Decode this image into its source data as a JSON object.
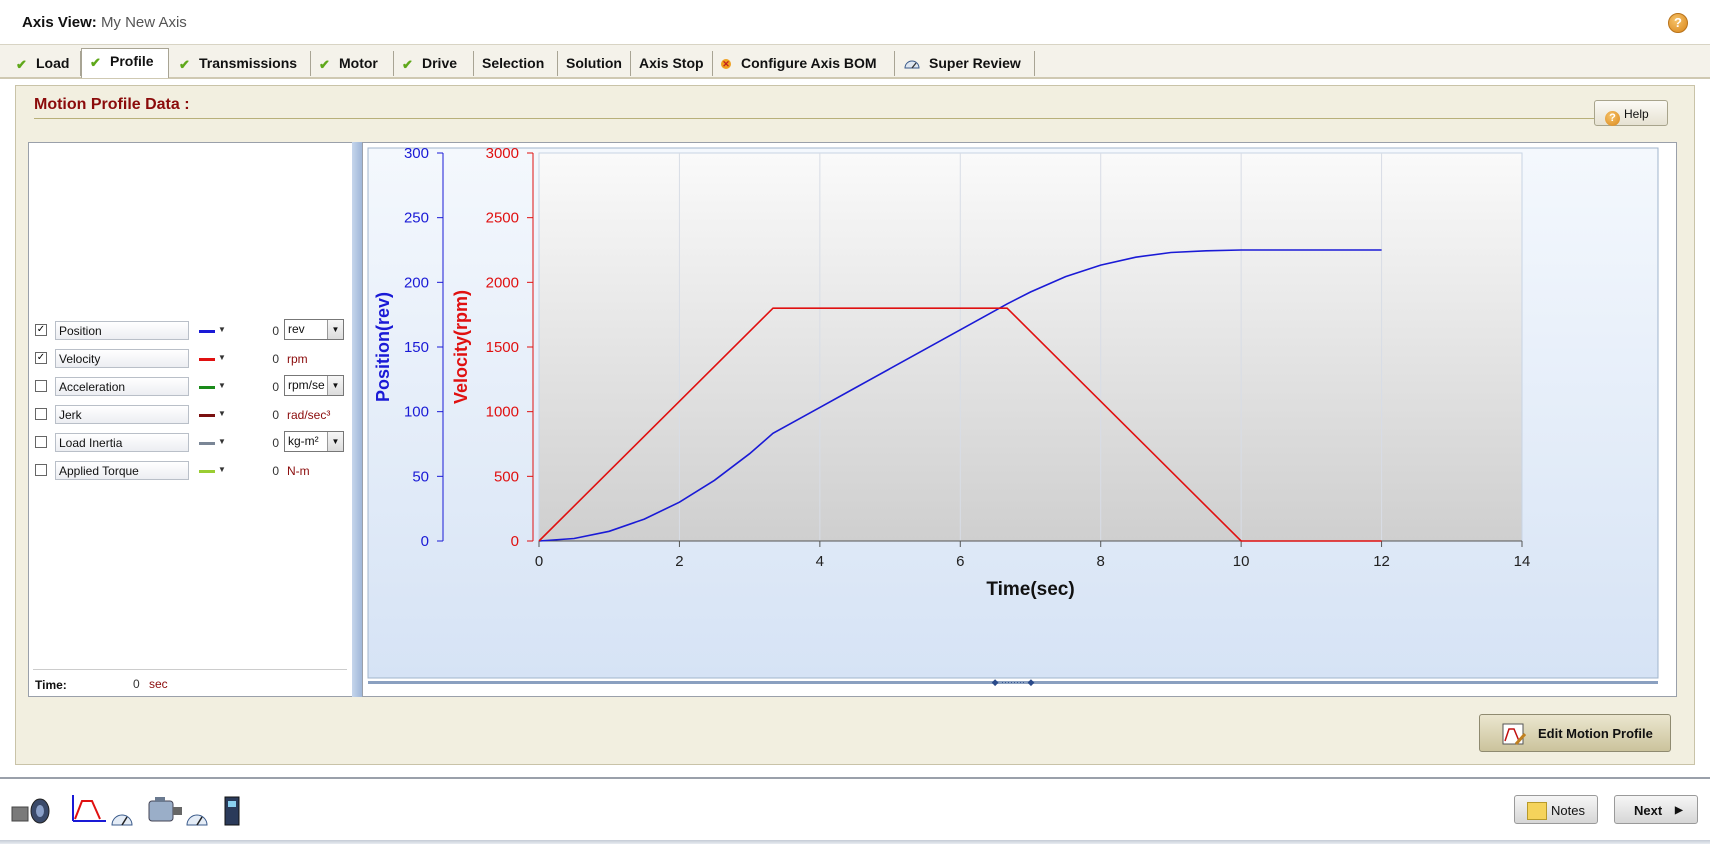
{
  "window": {
    "title": "Axis View:",
    "subtitle": "My New Axis",
    "help_icon": "question-icon"
  },
  "tabs": [
    {
      "label": "Load",
      "status": "check"
    },
    {
      "label": "Profile",
      "status": "check",
      "active": true
    },
    {
      "label": "Transmissions",
      "status": "check"
    },
    {
      "label": "Motor",
      "status": "check"
    },
    {
      "label": "Drive",
      "status": "check"
    },
    {
      "label": "Selection"
    },
    {
      "label": "Solution"
    },
    {
      "label": "Axis Stop"
    },
    {
      "label": "Configure Axis BOM",
      "status": "error"
    },
    {
      "label": "Super Review",
      "status": "gauge"
    }
  ],
  "panel": {
    "title": "Motion Profile Data :",
    "help_label": "Help"
  },
  "series_list": [
    {
      "checked": true,
      "name": "Position",
      "color": "#1a1ad6",
      "value": "0",
      "unit": "rev",
      "unit_is_select": true
    },
    {
      "checked": true,
      "name": "Velocity",
      "color": "#e01010",
      "value": "0",
      "unit": "rpm",
      "unit_is_select": false
    },
    {
      "checked": false,
      "name": "Acceleration",
      "color": "#1a8a1a",
      "value": "0",
      "unit": "rpm/se",
      "unit_is_select": true
    },
    {
      "checked": false,
      "name": "Jerk",
      "color": "#7a1010",
      "value": "0",
      "unit": "rad/sec³",
      "unit_is_select": false
    },
    {
      "checked": false,
      "name": "Load Inertia",
      "color": "#7a8696",
      "value": "0",
      "unit": "kg-m²",
      "unit_is_select": true
    },
    {
      "checked": false,
      "name": "Applied Torque",
      "color": "#9acd32",
      "value": "0",
      "unit": "N-m",
      "unit_is_select": false
    }
  ],
  "time": {
    "label": "Time:",
    "value": "0",
    "unit": "sec"
  },
  "chart_data": {
    "type": "line",
    "xlabel": "Time(sec)",
    "xlim": [
      0,
      14
    ],
    "x_ticks": [
      "0",
      "2",
      "4",
      "6",
      "8",
      "10",
      "12",
      "14"
    ],
    "grid": true,
    "axes": [
      {
        "label": "Position(rev)",
        "color": "#1a1ad6",
        "ylim": [
          0,
          300
        ],
        "ticks": [
          "0",
          "50",
          "100",
          "150",
          "200",
          "250",
          "300"
        ]
      },
      {
        "label": "Velocity(rpm)",
        "color": "#e01010",
        "ylim": [
          0,
          3000
        ],
        "ticks": [
          "0",
          "500",
          "1000",
          "1500",
          "2000",
          "2500",
          "3000"
        ]
      }
    ],
    "series": [
      {
        "axis": 0,
        "color": "#1a1ad6",
        "x": [
          0,
          0.5,
          1,
          1.5,
          2,
          2.5,
          3,
          3.333,
          4,
          4.5,
          5,
          5.5,
          6,
          6.5,
          6.667,
          7,
          7.5,
          8,
          8.5,
          9,
          9.5,
          10,
          12
        ],
        "y": [
          0,
          1.9,
          7.5,
          16.9,
          30,
          46.9,
          67.5,
          83.3,
          103.3,
          118.3,
          133.3,
          148.3,
          163.3,
          178.3,
          183.3,
          192.5,
          204.4,
          213.3,
          219.4,
          223.1,
          224.4,
          225,
          225
        ]
      },
      {
        "axis": 1,
        "color": "#e01010",
        "x": [
          0,
          3.333,
          6.667,
          10,
          12
        ],
        "y": [
          0,
          1800,
          1800,
          0,
          0
        ]
      }
    ]
  },
  "buttons": {
    "edit_profile": "Edit Motion Profile",
    "notes": "Notes",
    "next": "Next"
  },
  "workflow_icons": [
    "motor-load-icon",
    "profile-icon",
    "gauge-icon",
    "motor-icon",
    "gauge-icon",
    "drive-icon"
  ]
}
